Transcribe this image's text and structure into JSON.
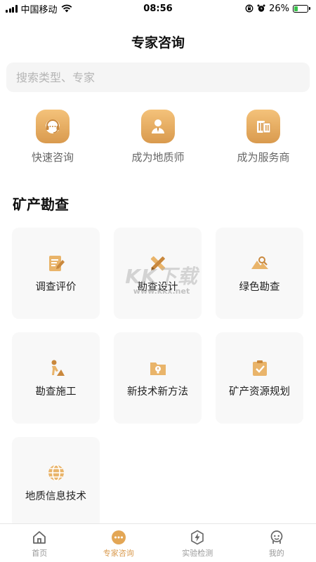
{
  "status_bar": {
    "carrier": "中国移动",
    "time": "08:56",
    "battery": "26%",
    "battery_level": 0.26
  },
  "header": {
    "title": "专家咨询"
  },
  "search": {
    "placeholder": "搜索类型、专家"
  },
  "quick_actions": [
    {
      "label": "快速咨询",
      "icon": "headset-icon"
    },
    {
      "label": "成为地质师",
      "icon": "person-icon"
    },
    {
      "label": "成为服务商",
      "icon": "building-icon"
    }
  ],
  "section": {
    "title": "矿产勘查"
  },
  "categories": [
    {
      "label": "调查评价",
      "icon": "document-pen-icon"
    },
    {
      "label": "勘查设计",
      "icon": "ruler-pencil-icon"
    },
    {
      "label": "绿色勘查",
      "icon": "mountain-search-icon"
    },
    {
      "label": "勘查施工",
      "icon": "worker-icon"
    },
    {
      "label": "新技术新方法",
      "icon": "folder-bulb-icon"
    },
    {
      "label": "矿产资源规划",
      "icon": "clipboard-check-icon"
    },
    {
      "label": "地质信息技术",
      "icon": "globe-icon"
    }
  ],
  "watermark": {
    "big": "KK下载",
    "small": "www.kkx.net"
  },
  "tabs": [
    {
      "label": "首页",
      "icon": "home-icon"
    },
    {
      "label": "专家咨询",
      "icon": "chat-dots-icon"
    },
    {
      "label": "实验检测",
      "icon": "lightning-icon"
    },
    {
      "label": "我的",
      "icon": "profile-icon"
    }
  ],
  "colors": {
    "accent": "#d99a4e",
    "accent_light": "#f4c27a",
    "card_bg": "#f8f8f8"
  }
}
